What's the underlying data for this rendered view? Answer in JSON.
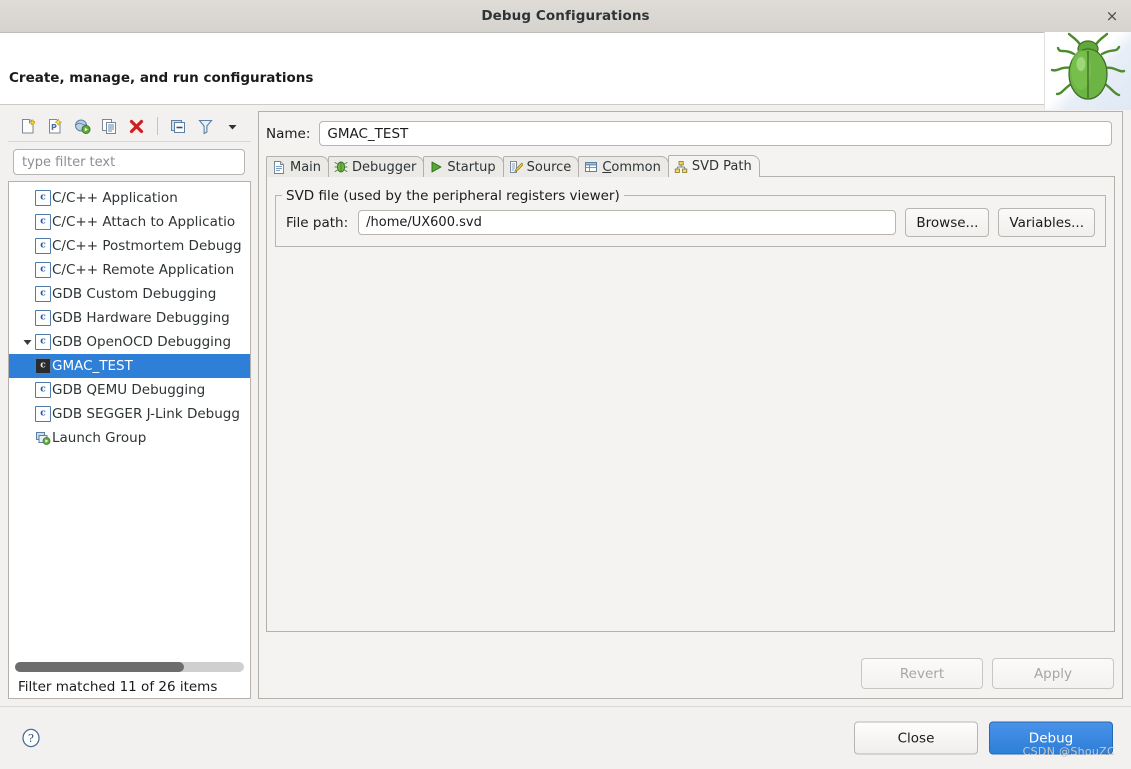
{
  "window": {
    "title": "Debug Configurations",
    "close_label": "×"
  },
  "header": {
    "title": "Create, manage, and run configurations",
    "banner_icon": "green-bug-icon"
  },
  "tree_toolbar": {
    "buttons": [
      {
        "name": "new-launch-configuration-icon",
        "tooltip": "New launch configuration"
      },
      {
        "name": "new-prototype-icon",
        "tooltip": "New prototype"
      },
      {
        "name": "export-icon",
        "tooltip": "Export"
      },
      {
        "name": "duplicate-icon",
        "tooltip": "Duplicate"
      },
      {
        "name": "delete-icon",
        "tooltip": "Delete"
      },
      {
        "name": "collapse-all-icon",
        "tooltip": "Collapse All"
      },
      {
        "name": "filter-icon",
        "tooltip": "Filter launch configurations"
      },
      {
        "name": "view-menu-icon",
        "tooltip": "View Menu"
      }
    ]
  },
  "filter": {
    "placeholder": "type filter text",
    "value": "",
    "status": "Filter matched 11 of 26 items"
  },
  "tree": {
    "items": [
      {
        "label": "C/C++ Application",
        "icon": "c-config-icon",
        "level": 0,
        "expander": "none",
        "selected": false
      },
      {
        "label": "C/C++ Attach to Applicatio",
        "icon": "c-config-icon",
        "level": 0,
        "expander": "none",
        "selected": false
      },
      {
        "label": "C/C++ Postmortem Debugg",
        "icon": "c-config-icon",
        "level": 0,
        "expander": "none",
        "selected": false
      },
      {
        "label": "C/C++ Remote Application",
        "icon": "c-config-icon",
        "level": 0,
        "expander": "none",
        "selected": false
      },
      {
        "label": "GDB Custom Debugging",
        "icon": "c-config-icon",
        "level": 0,
        "expander": "none",
        "selected": false
      },
      {
        "label": "GDB Hardware Debugging",
        "icon": "c-config-icon",
        "level": 0,
        "expander": "none",
        "selected": false
      },
      {
        "label": "GDB OpenOCD Debugging",
        "icon": "c-config-icon",
        "level": 0,
        "expander": "expanded",
        "selected": false
      },
      {
        "label": "GMAC_TEST",
        "icon": "c-config-icon-dark",
        "level": 1,
        "expander": "none",
        "selected": true
      },
      {
        "label": "GDB QEMU Debugging",
        "icon": "c-config-icon",
        "level": 0,
        "expander": "none",
        "selected": false
      },
      {
        "label": "GDB SEGGER J-Link Debugg",
        "icon": "c-config-icon",
        "level": 0,
        "expander": "none",
        "selected": false
      },
      {
        "label": "Launch Group",
        "icon": "launch-group-icon",
        "level": 0,
        "expander": "none",
        "selected": false
      }
    ]
  },
  "config": {
    "name_label": "Name:",
    "name_value": "GMAC_TEST",
    "tabs": [
      {
        "label": "Main",
        "icon": "document-icon",
        "active": false,
        "mnemonic": ""
      },
      {
        "label": "Debugger",
        "icon": "debugger-bug-icon",
        "active": false,
        "mnemonic": ""
      },
      {
        "label": "Startup",
        "icon": "run-play-icon",
        "active": false,
        "mnemonic": ""
      },
      {
        "label": "Source",
        "icon": "source-pencil-icon",
        "active": false,
        "mnemonic": ""
      },
      {
        "label": "Common",
        "icon": "common-table-icon",
        "active": false,
        "mnemonic": "C"
      },
      {
        "label": "SVD Path",
        "icon": "svd-hierarchy-icon",
        "active": true,
        "mnemonic": ""
      }
    ],
    "svd": {
      "group_title": "SVD file (used by the peripheral registers viewer)",
      "file_path_label": "File path:",
      "file_path_value": "/home/UX600.svd",
      "browse_label": "Browse...",
      "variables_label": "Variables..."
    },
    "revert_label": "Revert",
    "apply_label": "Apply"
  },
  "footer": {
    "help_icon": "help-question-icon",
    "close_label": "Close",
    "debug_label": "Debug"
  },
  "watermark": "CSDN @ShouZC",
  "colors": {
    "selection_blue": "#2d7fd8",
    "primary_button_blue": "#2d7fd8",
    "titlebar_gray": "#d6d3ce",
    "dialog_bg": "#f2f1f0",
    "bug_green": "#5ca53a"
  }
}
